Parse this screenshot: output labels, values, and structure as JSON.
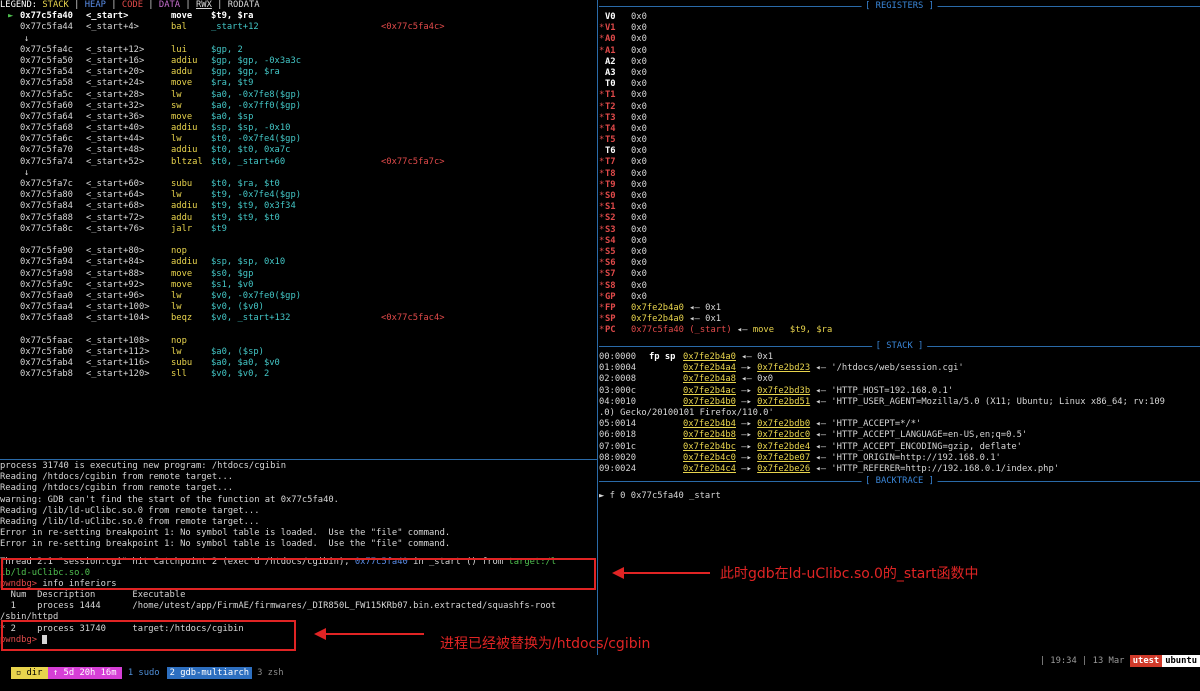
{
  "legend": {
    "prefix": "LEGEND: ",
    "stack": "STACK",
    "heap": "HEAP",
    "code": "CODE",
    "data": "DATA",
    "rwx": "RWX",
    "rodata": "RODATA",
    "sep": " | "
  },
  "disasm": [
    {
      "marker": "►",
      "addr": "0x77c5fa40",
      "sym": "<_start>",
      "op": "move",
      "args": "$t9, $ra",
      "note": "",
      "current": true
    },
    {
      "addr": "0x77c5fa44",
      "sym": "<_start+4>",
      "op": "bal",
      "args": "_start+12",
      "note": "<0x77c5fa4c>"
    },
    {
      "arrow": "↓"
    },
    {
      "addr": "0x77c5fa4c",
      "sym": "<_start+12>",
      "op": "lui",
      "args": "$gp, 2"
    },
    {
      "addr": "0x77c5fa50",
      "sym": "<_start+16>",
      "op": "addiu",
      "args": "$gp, $gp, -0x3a3c"
    },
    {
      "addr": "0x77c5fa54",
      "sym": "<_start+20>",
      "op": "addu",
      "args": "$gp, $gp, $ra"
    },
    {
      "addr": "0x77c5fa58",
      "sym": "<_start+24>",
      "op": "move",
      "args": "$ra, $t9"
    },
    {
      "addr": "0x77c5fa5c",
      "sym": "<_start+28>",
      "op": "lw",
      "args": "$a0, -0x7fe8($gp)"
    },
    {
      "addr": "0x77c5fa60",
      "sym": "<_start+32>",
      "op": "sw",
      "args": "$a0, -0x7ff0($gp)"
    },
    {
      "addr": "0x77c5fa64",
      "sym": "<_start+36>",
      "op": "move",
      "args": "$a0, $sp"
    },
    {
      "addr": "0x77c5fa68",
      "sym": "<_start+40>",
      "op": "addiu",
      "args": "$sp, $sp, -0x10"
    },
    {
      "addr": "0x77c5fa6c",
      "sym": "<_start+44>",
      "op": "lw",
      "args": "$t0, -0x7fe4($gp)"
    },
    {
      "addr": "0x77c5fa70",
      "sym": "<_start+48>",
      "op": "addiu",
      "args": "$t0, $t0, 0xa7c"
    },
    {
      "addr": "0x77c5fa74",
      "sym": "<_start+52>",
      "op": "bltzal",
      "args": "$t0, _start+60",
      "note": "<0x77c5fa7c>"
    },
    {
      "arrow": "↓"
    },
    {
      "addr": "0x77c5fa7c",
      "sym": "<_start+60>",
      "op": "subu",
      "args": "$t0, $ra, $t0"
    },
    {
      "addr": "0x77c5fa80",
      "sym": "<_start+64>",
      "op": "lw",
      "args": "$t9, -0x7fe4($gp)"
    },
    {
      "addr": "0x77c5fa84",
      "sym": "<_start+68>",
      "op": "addiu",
      "args": "$t9, $t9, 0x3f34"
    },
    {
      "addr": "0x77c5fa88",
      "sym": "<_start+72>",
      "op": "addu",
      "args": "$t9, $t9, $t0"
    },
    {
      "addr": "0x77c5fa8c",
      "sym": "<_start+76>",
      "op": "jalr",
      "args": "$t9"
    },
    {
      "blank": true
    },
    {
      "addr": "0x77c5fa90",
      "sym": "<_start+80>",
      "op": "nop",
      "args": ""
    },
    {
      "addr": "0x77c5fa94",
      "sym": "<_start+84>",
      "op": "addiu",
      "args": "$sp, $sp, 0x10"
    },
    {
      "addr": "0x77c5fa98",
      "sym": "<_start+88>",
      "op": "move",
      "args": "$s0, $gp"
    },
    {
      "addr": "0x77c5fa9c",
      "sym": "<_start+92>",
      "op": "move",
      "args": "$s1, $v0"
    },
    {
      "addr": "0x77c5faa0",
      "sym": "<_start+96>",
      "op": "lw",
      "args": "$v0, -0x7fe0($gp)"
    },
    {
      "addr": "0x77c5faa4",
      "sym": "<_start+100>",
      "op": "lw",
      "args": "$v0, ($v0)"
    },
    {
      "addr": "0x77c5faa8",
      "sym": "<_start+104>",
      "op": "beqz",
      "args": "$v0, _start+132",
      "note": "<0x77c5fac4>"
    },
    {
      "blank": true
    },
    {
      "addr": "0x77c5faac",
      "sym": "<_start+108>",
      "op": "nop",
      "args": ""
    },
    {
      "addr": "0x77c5fab0",
      "sym": "<_start+112>",
      "op": "lw",
      "args": "$a0, ($sp)"
    },
    {
      "addr": "0x77c5fab4",
      "sym": "<_start+116>",
      "op": "subu",
      "args": "$a0, $a0, $v0"
    },
    {
      "addr": "0x77c5fab8",
      "sym": "<_start+120>",
      "op": "sll",
      "args": "$v0, $v0, 2"
    }
  ],
  "registers_title": "REGISTERS",
  "registers": [
    {
      "name": "V0",
      "val": "0x0",
      "star": false
    },
    {
      "name": "V1",
      "val": "0x0",
      "star": true
    },
    {
      "name": "A0",
      "val": "0x0",
      "star": true
    },
    {
      "name": "A1",
      "val": "0x0",
      "star": true
    },
    {
      "name": "A2",
      "val": "0x0",
      "star": false
    },
    {
      "name": "A3",
      "val": "0x0",
      "star": false
    },
    {
      "name": "T0",
      "val": "0x0",
      "star": false
    },
    {
      "name": "T1",
      "val": "0x0",
      "star": true
    },
    {
      "name": "T2",
      "val": "0x0",
      "star": true
    },
    {
      "name": "T3",
      "val": "0x0",
      "star": true
    },
    {
      "name": "T4",
      "val": "0x0",
      "star": true
    },
    {
      "name": "T5",
      "val": "0x0",
      "star": true
    },
    {
      "name": "T6",
      "val": "0x0",
      "star": false
    },
    {
      "name": "T7",
      "val": "0x0",
      "star": true
    },
    {
      "name": "T8",
      "val": "0x0",
      "star": true
    },
    {
      "name": "T9",
      "val": "0x0",
      "star": true
    },
    {
      "name": "S0",
      "val": "0x0",
      "star": true
    },
    {
      "name": "S1",
      "val": "0x0",
      "star": true
    },
    {
      "name": "S2",
      "val": "0x0",
      "star": true
    },
    {
      "name": "S3",
      "val": "0x0",
      "star": true
    },
    {
      "name": "S4",
      "val": "0x0",
      "star": true
    },
    {
      "name": "S5",
      "val": "0x0",
      "star": true
    },
    {
      "name": "S6",
      "val": "0x0",
      "star": true
    },
    {
      "name": "S7",
      "val": "0x0",
      "star": true
    },
    {
      "name": "S8",
      "val": "0x0",
      "star": true
    },
    {
      "name": "GP",
      "val": "0x0",
      "star": true
    },
    {
      "name": "FP",
      "val": "0x7fe2b4a0",
      "ptr": "0x1",
      "star": true
    },
    {
      "name": "SP",
      "val": "0x7fe2b4a0",
      "ptr": "0x1",
      "star": true
    },
    {
      "name": "PC",
      "val": "0x77c5fa40 (_start)",
      "ptr": "move   $t9, $ra",
      "star": true
    }
  ],
  "stack_title": "STACK",
  "stack": [
    {
      "off": "00:0000",
      "tag": "fp sp",
      "addr": "0x7fe2b4a0",
      "rest": " ◂— 0x1"
    },
    {
      "off": "01:0004",
      "tag": "",
      "addr": "0x7fe2b4a4",
      "to": "0x7fe2bd23",
      "rest": " ◂— '/htdocs/web/session.cgi'"
    },
    {
      "off": "02:0008",
      "tag": "",
      "addr": "0x7fe2b4a8",
      "rest": " ◂— 0x0"
    },
    {
      "off": "03:000c",
      "tag": "",
      "addr": "0x7fe2b4ac",
      "to": "0x7fe2bd3b",
      "rest": " ◂— 'HTTP_HOST=192.168.0.1'"
    },
    {
      "off": "04:0010",
      "tag": "",
      "addr": "0x7fe2b4b0",
      "to": "0x7fe2bd51",
      "rest": " ◂— 'HTTP_USER_AGENT=Mozilla/5.0 (X11; Ubuntu; Linux x86_64; rv:109"
    },
    {
      "wrap": ".0) Gecko/20100101 Firefox/110.0'"
    },
    {
      "off": "05:0014",
      "tag": "",
      "addr": "0x7fe2b4b4",
      "to": "0x7fe2bdb0",
      "rest": " ◂— 'HTTP_ACCEPT=*/*'"
    },
    {
      "off": "06:0018",
      "tag": "",
      "addr": "0x7fe2b4b8",
      "to": "0x7fe2bdc0",
      "rest": " ◂— 'HTTP_ACCEPT_LANGUAGE=en-US,en;q=0.5'"
    },
    {
      "off": "07:001c",
      "tag": "",
      "addr": "0x7fe2b4bc",
      "to": "0x7fe2bde4",
      "rest": " ◂— 'HTTP_ACCEPT_ENCODING=gzip, deflate'"
    },
    {
      "off": "08:0020",
      "tag": "",
      "addr": "0x7fe2b4c0",
      "to": "0x7fe2be07",
      "rest": " ◂— 'HTTP_ORIGIN=http://192.168.0.1'"
    },
    {
      "off": "09:0024",
      "tag": "",
      "addr": "0x7fe2b4c4",
      "to": "0x7fe2be26",
      "rest": " ◂— 'HTTP_REFERER=http://192.168.0.1/index.php'"
    }
  ],
  "backtrace_title": "BACKTRACE",
  "backtrace": [
    "► f 0 0x77c5fa40 _start"
  ],
  "console": {
    "lines": [
      "process 31740 is executing new program: /htdocs/cgibin",
      "Reading /htdocs/cgibin from remote target...",
      "Reading /htdocs/cgibin from remote target...",
      "warning: GDB can't find the start of the function at 0x77c5fa40.",
      "Reading /lib/ld-uClibc.so.0 from remote target...",
      "Reading /lib/ld-uClibc.so.0 from remote target...",
      "Error in re-setting breakpoint 1: No symbol table is loaded.  Use the \"file\" command.",
      "Error in re-setting breakpoint 1: No symbol table is loaded.  Use the \"file\" command."
    ],
    "thread_a": "Thread 2.1 \"session.cgi\" hit Catchpoint 2 (exec'd /htdocs/cgibin), ",
    "thread_addr": "0x77c5fa40",
    "thread_b": " in _start () from ",
    "thread_lib1": "target:/l",
    "thread_lib2": "ib/ld-uClibc.so.0",
    "prompt": "pwndbg>",
    "cmd": " info inferiors",
    "inf_header": "  Num  Description       Executable",
    "inf_1": "  1    process 1444      /home/utest/app/FirmAE/firmwares/_DIR850L_FW115KRb07.bin.extracted/squashfs-root",
    "inf_1b": "/sbin/httpd",
    "inf_2": "* 2    process 31740     target:/htdocs/cgibin"
  },
  "annotations": {
    "note1": "此时gdb在ld-uClibc.so.0的_start函数中",
    "note2": "进程已经被替换为/htdocs/cgibin"
  },
  "statusbar": {
    "tab0": " dir ",
    "tab1": " 5d 20h 16m ",
    "tab2": "1 sudo",
    "tab3": "2 gdb-multiarch",
    "tab4": "3 zsh",
    "right": "| 19:34 | 13 Mar ",
    "user": "utest",
    "host": "ubuntu"
  },
  "colors": {
    "accent_blue": "#2a6aa8",
    "annot_red": "#e02424",
    "pwndbg_red": "#e04a4a",
    "addr_yellow": "#e8d44d"
  }
}
